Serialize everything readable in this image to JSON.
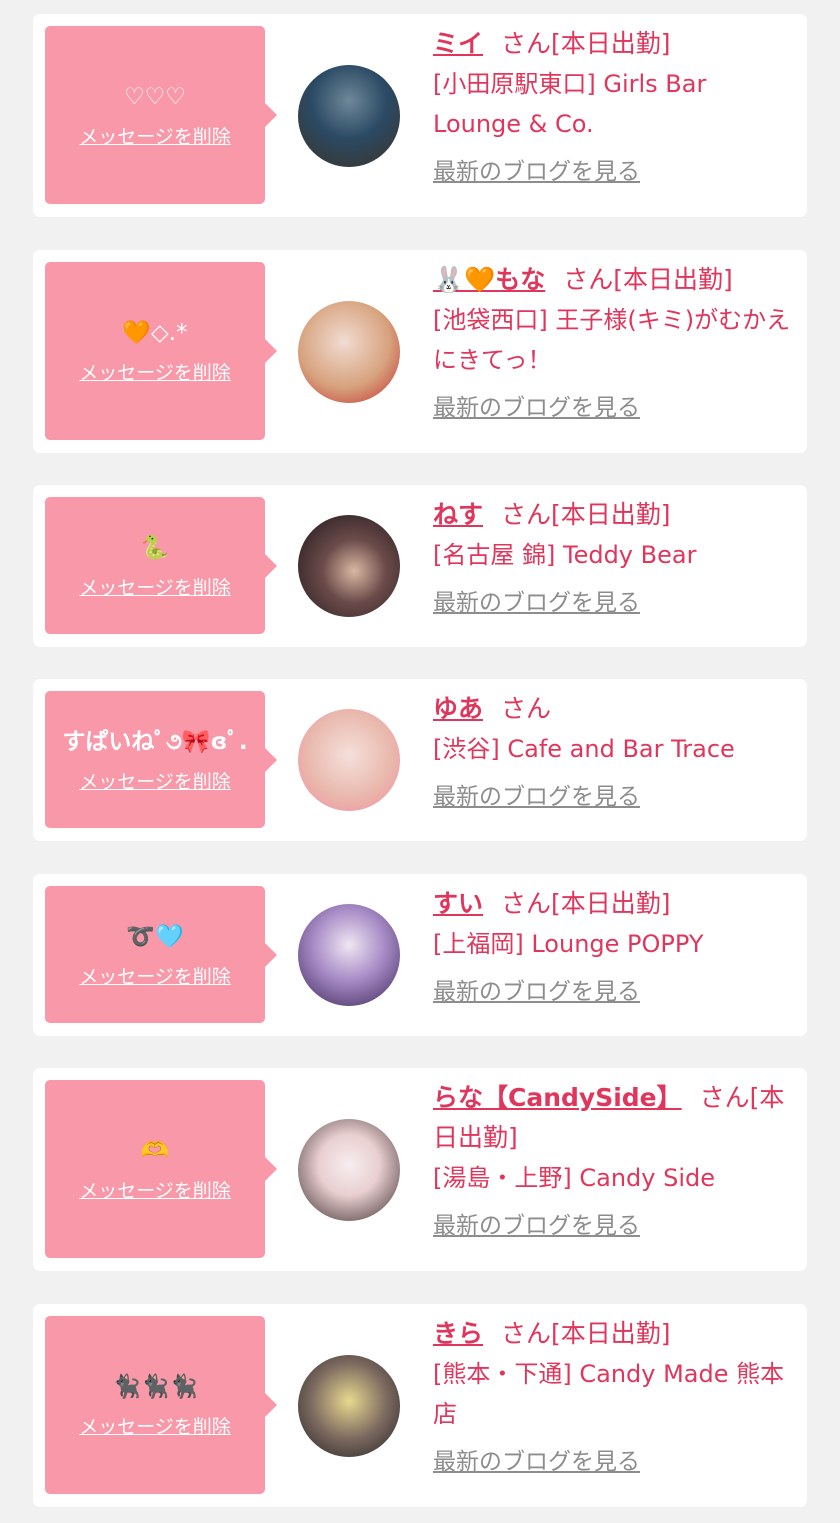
{
  "cards": [
    {
      "message": "♡♡♡",
      "delete_label": "メッセージを削除",
      "name": "ミイ",
      "suffix": "さん[本日出勤]",
      "shop": "[小田原駅東口] Girls Bar Lounge & Co.",
      "blog_label": "最新のブログを見る",
      "avatar_colors": [
        "#2b4a64",
        "#6f8899",
        "#3c3228"
      ]
    },
    {
      "message": "🧡◇.*",
      "delete_label": "メッセージを削除",
      "name": "🐰🧡もな",
      "suffix": "さん[本日出勤]",
      "shop": "[池袋西口] 王子様(キミ)がむかえにきてっ！",
      "blog_label": "最新のブログを見る",
      "avatar_colors": [
        "#f1dcd2",
        "#d7a27d",
        "#c12a2a"
      ]
    },
    {
      "message": "🐍",
      "delete_label": "メッセージを削除",
      "name": "ねす",
      "suffix": "さん[本日出勤]",
      "shop": "[名古屋 錦] Teddy Bear",
      "blog_label": "最新のブログを見る",
      "avatar_colors": [
        "#1c1418",
        "#6b4b4a",
        "#d9b8a3"
      ]
    },
    {
      "message": "すぱいねﾟ૭🎀ɞﾟ.",
      "delete_label": "メッセージを削除",
      "name": "ゆあ",
      "suffix": "さん",
      "shop": "[渋谷] Cafe and Bar Trace",
      "blog_label": "最新のブログを見る",
      "avatar_colors": [
        "#f5e0dc",
        "#e9b9ad",
        "#f38aa0"
      ]
    },
    {
      "message": "➰🩵",
      "delete_label": "メッセージを削除",
      "name": "すい",
      "suffix": "さん[本日出勤]",
      "shop": "[上福岡] Lounge POPPY",
      "blog_label": "最新のブログを見る",
      "avatar_colors": [
        "#3a2455",
        "#a78bc6",
        "#f0e6f2"
      ]
    },
    {
      "message": "🫶",
      "delete_label": "メッセージを削除",
      "name": "らな【CandySide】",
      "suffix": "さん[本日出勤]",
      "shop": "[湯島・上野] Candy Side",
      "blog_label": "最新のブログを見る",
      "avatar_colors": [
        "#f6eef0",
        "#3a2a2c",
        "#e9cfd0"
      ]
    },
    {
      "message": "🐈‍⬛🐈‍⬛🐈‍⬛",
      "delete_label": "メッセージを削除",
      "name": "きら",
      "suffix": "さん[本日出勤]",
      "shop": "[熊本・下通] Candy Made 熊本店",
      "blog_label": "最新のブログを見る",
      "avatar_colors": [
        "#7d6a60",
        "#e8d98e",
        "#1f1f22"
      ]
    }
  ]
}
